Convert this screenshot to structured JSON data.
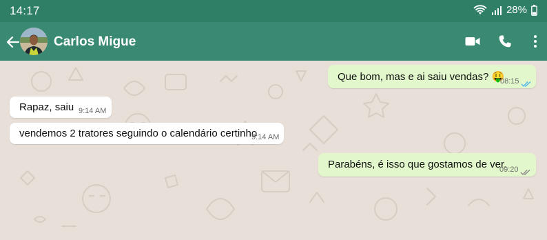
{
  "status_bar": {
    "time": "14:17",
    "battery": "28%",
    "icons": [
      "wifi-icon",
      "signal-icon",
      "battery-icon"
    ]
  },
  "header": {
    "contact_name": "Carlos Migue",
    "icons": [
      "back-arrow-icon",
      "video-call-icon",
      "phone-call-icon",
      "more-options-icon"
    ]
  },
  "messages": [
    {
      "direction": "outgoing",
      "text": "Que bom, mas e ai saiu vendas?",
      "emoji": "🤑",
      "time": "08:15",
      "status": "read"
    },
    {
      "direction": "incoming",
      "text": "Rapaz, saiu",
      "time": "9:14 AM"
    },
    {
      "direction": "incoming",
      "text": "vendemos 2 tratores seguindo o calendário certinho",
      "time": "9:14 AM"
    },
    {
      "direction": "outgoing",
      "text": "Parabéns, é isso que gostamos de ver.",
      "time": "09:20",
      "status": "delivered"
    }
  ],
  "colors": {
    "status_bar_bg": "#2f7f67",
    "header_bg": "#3a8a73",
    "chat_bg": "#e8e0d8",
    "outgoing_bubble": "#e2f7cb",
    "incoming_bubble": "#ffffff",
    "read_check": "#4fb6ec",
    "delivered_check": "#8c8c8c"
  }
}
